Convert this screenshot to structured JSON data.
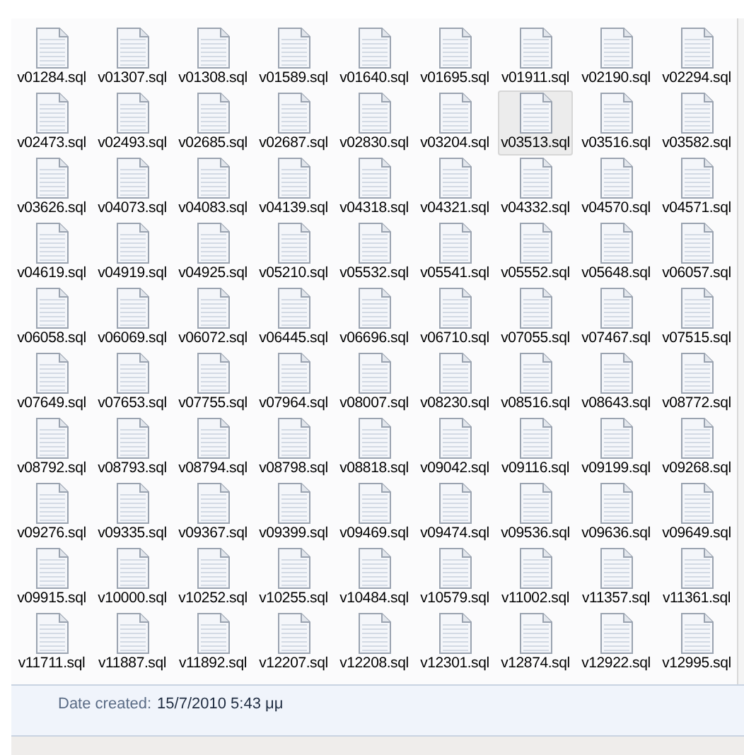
{
  "files": [
    {
      "name": "v01284.sql",
      "selected": false
    },
    {
      "name": "v01307.sql",
      "selected": false
    },
    {
      "name": "v01308.sql",
      "selected": false
    },
    {
      "name": "v01589.sql",
      "selected": false
    },
    {
      "name": "v01640.sql",
      "selected": false
    },
    {
      "name": "v01695.sql",
      "selected": false
    },
    {
      "name": "v01911.sql",
      "selected": false
    },
    {
      "name": "v02190.sql",
      "selected": false
    },
    {
      "name": "v02294.sql",
      "selected": false
    },
    {
      "name": "v02473.sql",
      "selected": false
    },
    {
      "name": "v02493.sql",
      "selected": false
    },
    {
      "name": "v02685.sql",
      "selected": false
    },
    {
      "name": "v02687.sql",
      "selected": false
    },
    {
      "name": "v02830.sql",
      "selected": false
    },
    {
      "name": "v03204.sql",
      "selected": false
    },
    {
      "name": "v03513.sql",
      "selected": true
    },
    {
      "name": "v03516.sql",
      "selected": false
    },
    {
      "name": "v03582.sql",
      "selected": false
    },
    {
      "name": "v03626.sql",
      "selected": false
    },
    {
      "name": "v04073.sql",
      "selected": false
    },
    {
      "name": "v04083.sql",
      "selected": false
    },
    {
      "name": "v04139.sql",
      "selected": false
    },
    {
      "name": "v04318.sql",
      "selected": false
    },
    {
      "name": "v04321.sql",
      "selected": false
    },
    {
      "name": "v04332.sql",
      "selected": false
    },
    {
      "name": "v04570.sql",
      "selected": false
    },
    {
      "name": "v04571.sql",
      "selected": false
    },
    {
      "name": "v04619.sql",
      "selected": false
    },
    {
      "name": "v04919.sql",
      "selected": false
    },
    {
      "name": "v04925.sql",
      "selected": false
    },
    {
      "name": "v05210.sql",
      "selected": false
    },
    {
      "name": "v05532.sql",
      "selected": false
    },
    {
      "name": "v05541.sql",
      "selected": false
    },
    {
      "name": "v05552.sql",
      "selected": false
    },
    {
      "name": "v05648.sql",
      "selected": false
    },
    {
      "name": "v06057.sql",
      "selected": false
    },
    {
      "name": "v06058.sql",
      "selected": false
    },
    {
      "name": "v06069.sql",
      "selected": false
    },
    {
      "name": "v06072.sql",
      "selected": false
    },
    {
      "name": "v06445.sql",
      "selected": false
    },
    {
      "name": "v06696.sql",
      "selected": false
    },
    {
      "name": "v06710.sql",
      "selected": false
    },
    {
      "name": "v07055.sql",
      "selected": false
    },
    {
      "name": "v07467.sql",
      "selected": false
    },
    {
      "name": "v07515.sql",
      "selected": false
    },
    {
      "name": "v07649.sql",
      "selected": false
    },
    {
      "name": "v07653.sql",
      "selected": false
    },
    {
      "name": "v07755.sql",
      "selected": false
    },
    {
      "name": "v07964.sql",
      "selected": false
    },
    {
      "name": "v08007.sql",
      "selected": false
    },
    {
      "name": "v08230.sql",
      "selected": false
    },
    {
      "name": "v08516.sql",
      "selected": false
    },
    {
      "name": "v08643.sql",
      "selected": false
    },
    {
      "name": "v08772.sql",
      "selected": false
    },
    {
      "name": "v08792.sql",
      "selected": false
    },
    {
      "name": "v08793.sql",
      "selected": false
    },
    {
      "name": "v08794.sql",
      "selected": false
    },
    {
      "name": "v08798.sql",
      "selected": false
    },
    {
      "name": "v08818.sql",
      "selected": false
    },
    {
      "name": "v09042.sql",
      "selected": false
    },
    {
      "name": "v09116.sql",
      "selected": false
    },
    {
      "name": "v09199.sql",
      "selected": false
    },
    {
      "name": "v09268.sql",
      "selected": false
    },
    {
      "name": "v09276.sql",
      "selected": false
    },
    {
      "name": "v09335.sql",
      "selected": false
    },
    {
      "name": "v09367.sql",
      "selected": false
    },
    {
      "name": "v09399.sql",
      "selected": false
    },
    {
      "name": "v09469.sql",
      "selected": false
    },
    {
      "name": "v09474.sql",
      "selected": false
    },
    {
      "name": "v09536.sql",
      "selected": false
    },
    {
      "name": "v09636.sql",
      "selected": false
    },
    {
      "name": "v09649.sql",
      "selected": false
    },
    {
      "name": "v09915.sql",
      "selected": false
    },
    {
      "name": "v10000.sql",
      "selected": false
    },
    {
      "name": "v10252.sql",
      "selected": false
    },
    {
      "name": "v10255.sql",
      "selected": false
    },
    {
      "name": "v10484.sql",
      "selected": false
    },
    {
      "name": "v10579.sql",
      "selected": false
    },
    {
      "name": "v11002.sql",
      "selected": false
    },
    {
      "name": "v11357.sql",
      "selected": false
    },
    {
      "name": "v11361.sql",
      "selected": false
    },
    {
      "name": "v11711.sql",
      "selected": false
    },
    {
      "name": "v11887.sql",
      "selected": false
    },
    {
      "name": "v11892.sql",
      "selected": false
    },
    {
      "name": "v12207.sql",
      "selected": false
    },
    {
      "name": "v12208.sql",
      "selected": false
    },
    {
      "name": "v12301.sql",
      "selected": false
    },
    {
      "name": "v12874.sql",
      "selected": false
    },
    {
      "name": "v12922.sql",
      "selected": false
    },
    {
      "name": "v12995.sql",
      "selected": false
    }
  ],
  "details": {
    "label": "Date created:",
    "value": "15/7/2010 5:43 μμ"
  }
}
